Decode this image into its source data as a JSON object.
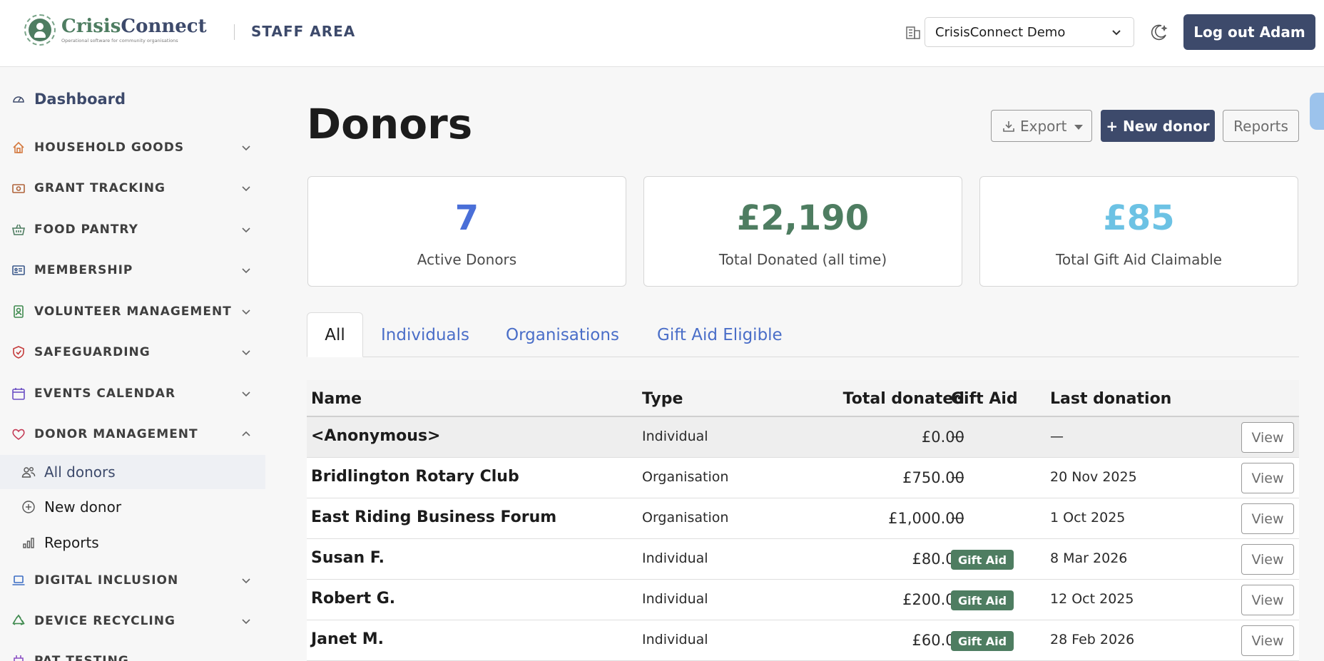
{
  "header": {
    "brand_part1": "Crisis",
    "brand_part2": "Connect",
    "brand_tagline": "Operational software for community organisations",
    "area": "STAFF AREA",
    "org_selected": "CrisisConnect Demo",
    "logout_label": "Log out Adam"
  },
  "sidebar": {
    "dashboard": "Dashboard",
    "sections": [
      {
        "label": "HOUSEHOLD GOODS",
        "icon": "house-icon",
        "color": "#d4793f"
      },
      {
        "label": "GRANT TRACKING",
        "icon": "cash-icon",
        "color": "#b0643a"
      },
      {
        "label": "FOOD PANTRY",
        "icon": "basket-icon",
        "color": "#4e7d61"
      },
      {
        "label": "MEMBERSHIP",
        "icon": "id-card-icon",
        "color": "#3d5a8c"
      },
      {
        "label": "VOLUNTEER MANAGEMENT",
        "icon": "badge-icon",
        "color": "#3f8a4f"
      },
      {
        "label": "SAFEGUARDING",
        "icon": "shield-icon",
        "color": "#c43a3a"
      },
      {
        "label": "EVENTS CALENDAR",
        "icon": "calendar-icon",
        "color": "#6b4fc4"
      },
      {
        "label": "DONOR MANAGEMENT",
        "icon": "heart-icon",
        "color": "#c43a55"
      },
      {
        "label": "DIGITAL INCLUSION",
        "icon": "laptop-icon",
        "color": "#3d6fc4"
      },
      {
        "label": "DEVICE RECYCLING",
        "icon": "recycle-icon",
        "color": "#3f8a4f"
      },
      {
        "label": "PAT TESTING",
        "icon": "plug-icon",
        "color": "#8a4fc4"
      }
    ],
    "donor_sub": [
      {
        "label": "All donors",
        "icon": "people-icon"
      },
      {
        "label": "New donor",
        "icon": "plus-circle-icon"
      },
      {
        "label": "Reports",
        "icon": "bar-chart-icon"
      }
    ]
  },
  "main": {
    "title": "Donors",
    "export_label": "Export",
    "new_label": "+ New donor",
    "reports_label": "Reports",
    "stats": [
      {
        "value": "7",
        "caption": "Active Donors",
        "color": "#4a6fd8"
      },
      {
        "value": "£2,190",
        "caption": "Total Donated (all time)",
        "color": "#4e7d61"
      },
      {
        "value": "£85",
        "caption": "Total Gift Aid Claimable",
        "color": "#6cc2e4"
      }
    ],
    "tabs": [
      "All",
      "Individuals",
      "Organisations",
      "Gift Aid Eligible"
    ],
    "columns": [
      "Name",
      "Type",
      "Total donated",
      "Gift Aid",
      "Last donation"
    ],
    "rows": [
      {
        "name": "<Anonymous>",
        "type": "Individual",
        "total": "£0.00",
        "gift_aid": "—",
        "last": "—"
      },
      {
        "name": "Bridlington Rotary Club",
        "type": "Organisation",
        "total": "£750.00",
        "gift_aid": "—",
        "last": "20 Nov 2025"
      },
      {
        "name": "East Riding Business Forum",
        "type": "Organisation",
        "total": "£1,000.00",
        "gift_aid": "—",
        "last": "1 Oct 2025"
      },
      {
        "name": "Susan F.",
        "type": "Individual",
        "total": "£80.00",
        "gift_aid": "Gift Aid",
        "last": "8 Mar 2026"
      },
      {
        "name": "Robert G.",
        "type": "Individual",
        "total": "£200.00",
        "gift_aid": "Gift Aid",
        "last": "12 Oct 2025"
      },
      {
        "name": "Janet M.",
        "type": "Individual",
        "total": "£60.00",
        "gift_aid": "Gift Aid",
        "last": "28 Feb 2026"
      }
    ],
    "view_label": "View"
  }
}
